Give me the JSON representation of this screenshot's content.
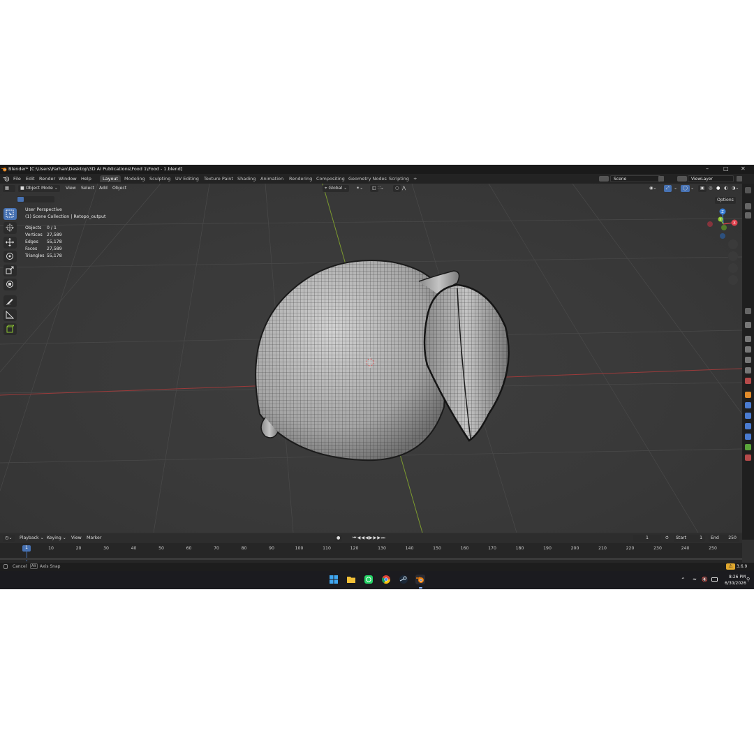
{
  "window": {
    "title": "Blender* [C:\\Users\\Farhan\\Desktop\\3D AI Publications\\Food 1\\Food - 1.blend]",
    "minimize": "–",
    "maximize": "□",
    "close": "✕"
  },
  "menu": [
    "File",
    "Edit",
    "Render",
    "Window",
    "Help"
  ],
  "workspace_tabs": [
    "Layout",
    "Modeling",
    "Sculpting",
    "UV Editing",
    "Texture Paint",
    "Shading",
    "Animation",
    "Rendering",
    "Compositing",
    "Geometry Nodes",
    "Scripting"
  ],
  "active_tab": "Layout",
  "add_tab": "+",
  "scene": "Scene",
  "view_layer": "ViewLayer",
  "viewport_header": {
    "mode": "Object Mode",
    "menus": [
      "View",
      "Select",
      "Add",
      "Object"
    ],
    "transform_orientation": "Global",
    "options": "Options"
  },
  "overlay_info": {
    "perspective": "User Perspective",
    "collection": "(1) Scene Collection | Retopo_output"
  },
  "stats": [
    {
      "label": "Objects",
      "value": "0 / 1"
    },
    {
      "label": "Vertices",
      "value": "27,589"
    },
    {
      "label": "Edges",
      "value": "55,178"
    },
    {
      "label": "Faces",
      "value": "27,589"
    },
    {
      "label": "Triangles",
      "value": "55,178"
    }
  ],
  "gizmo_axes": {
    "x": "X",
    "y": "Y",
    "z": "Z"
  },
  "colors": {
    "accent": "#4772b3",
    "axis_x": "#e0434f",
    "axis_y": "#8fc833",
    "axis_z": "#3a7fd8"
  },
  "timeline": {
    "menus": [
      "Playback",
      "Keying",
      "View",
      "Marker"
    ],
    "current_frame": "1",
    "start_label": "Start",
    "start": "1",
    "end_label": "End",
    "end": "250",
    "ticks": [
      "1",
      "10",
      "20",
      "30",
      "40",
      "50",
      "60",
      "70",
      "80",
      "90",
      "100",
      "110",
      "120",
      "130",
      "140",
      "150",
      "160",
      "170",
      "180",
      "190",
      "200",
      "210",
      "220",
      "230",
      "240",
      "250"
    ]
  },
  "status_bar": {
    "cancel": "Cancel",
    "alt_key": "Alt",
    "axis_snap": "Axis Snap",
    "version": "3.6.9"
  },
  "taskbar": {
    "apps": [
      "windows-start-icon",
      "file-explorer-icon",
      "whatsapp-icon",
      "chrome-icon",
      "steam-icon",
      "blender-icon"
    ],
    "time": "8:26 PM",
    "date": "6/30/2026"
  }
}
